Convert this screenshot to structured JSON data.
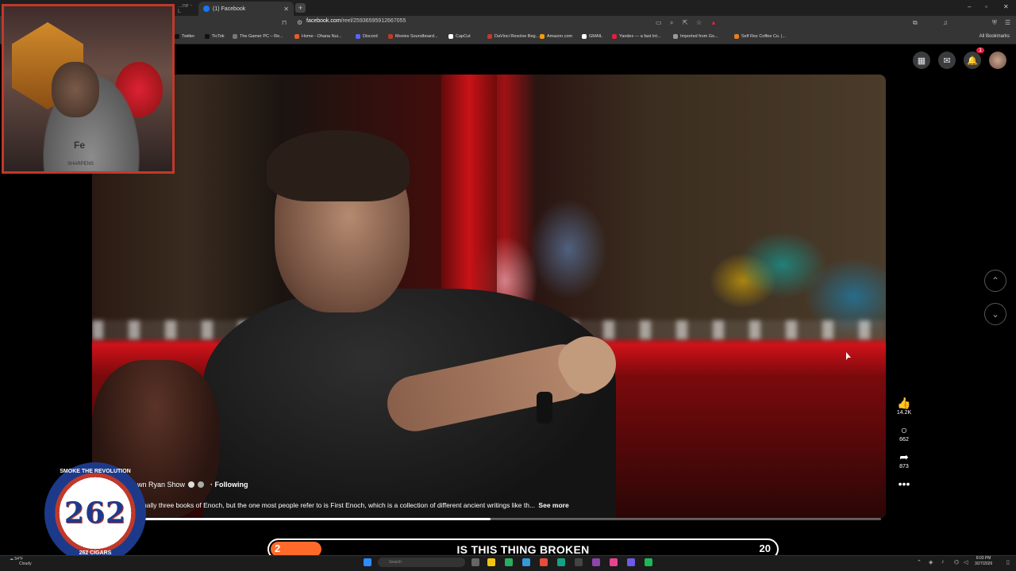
{
  "browser": {
    "tab_ghost_label": "...ne - L",
    "tab_active_label": "(1) Facebook",
    "url_host": "facebook.com",
    "url_path": "/reel/25936595912667055",
    "bookmarks": [
      {
        "label": "Twitter",
        "color": "#111111"
      },
      {
        "label": "TicTok",
        "color": "#111111"
      },
      {
        "label": "The Gamer PC – Re...",
        "color": "#777777"
      },
      {
        "label": "Home - Ohana Nui...",
        "color": "#e45b2a"
      },
      {
        "label": "Discord",
        "color": "#5865f2"
      },
      {
        "label": "Movies Soundboard...",
        "color": "#c0392b"
      },
      {
        "label": "CapCut",
        "color": "#ffffff"
      },
      {
        "label": "DaVinci Resolve Beg...",
        "color": "#c0392b"
      },
      {
        "label": "Amazon.com",
        "color": "#f39c12"
      },
      {
        "label": "GMAIL",
        "color": "#ffffff"
      },
      {
        "label": "Yandex — a fast Int...",
        "color": "#e41e3f"
      },
      {
        "label": "Imported from Go...",
        "color": "#999999"
      },
      {
        "label": "Self Rez Coffee Co. |...",
        "color": "#e67e22"
      }
    ],
    "all_bookmarks": "All Bookmarks"
  },
  "reel": {
    "author": "wn Ryan Show",
    "following": "· Following",
    "caption": "ually three books of Enoch, but the one most people refer to is First Enoch, which is a collection of different ancient writings like th...",
    "see_more": "See more",
    "progress": 0.47,
    "likes": "14.2K",
    "comments": "662",
    "shares": "873",
    "notification_count": "1"
  },
  "overlay": {
    "logo_top": "SMOKE THE REVOLUTION",
    "logo_number": "262",
    "logo_bottom": "262 CIGARS",
    "poll_left": "2",
    "poll_title": "IS THIS THING BROKEN",
    "poll_right": "20",
    "poll_fill": 0.1,
    "webcam_shirt": "Fe",
    "webcam_shirt_sub": "SHARPENS"
  },
  "taskbar": {
    "weather_temp": "54°F",
    "weather_desc": "Cloudy",
    "search_placeholder": "Search",
    "time": "8:03 PM",
    "date": "3/27/2026"
  }
}
